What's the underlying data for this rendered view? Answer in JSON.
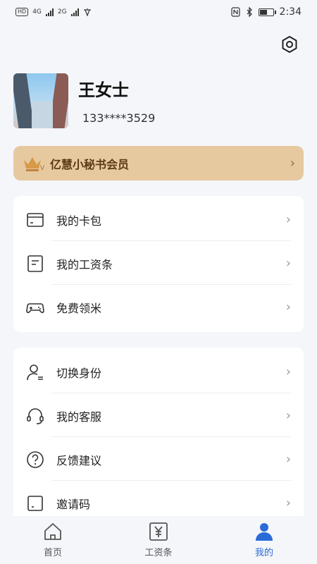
{
  "status_bar": {
    "left_badge": "HD",
    "net1": "4G",
    "net2": "2G",
    "time": "2:34",
    "battery_level": 0.6
  },
  "profile": {
    "name": "王女士",
    "phone": "133****3529"
  },
  "vip": {
    "label": "亿慧小秘书会员"
  },
  "menu_group_1": [
    {
      "label": "我的卡包",
      "icon": "card-wallet-icon"
    },
    {
      "label": "我的工资条",
      "icon": "payslip-icon"
    },
    {
      "label": "免费领米",
      "icon": "gamepad-icon"
    }
  ],
  "menu_group_2": [
    {
      "label": "切换身份",
      "icon": "switch-identity-icon"
    },
    {
      "label": "我的客服",
      "icon": "headset-icon"
    },
    {
      "label": "反馈建议",
      "icon": "feedback-question-icon"
    },
    {
      "label": "邀请码",
      "icon": "invite-code-icon"
    }
  ],
  "tabs": [
    {
      "label": "首页",
      "icon": "home-icon",
      "active": false
    },
    {
      "label": "工资条",
      "icon": "yen-payslip-icon",
      "active": false
    },
    {
      "label": "我的",
      "icon": "person-icon",
      "active": true
    }
  ],
  "colors": {
    "accent": "#2a6bd8",
    "vip_bg": "#e7c9a0",
    "vip_text": "#5b3b14",
    "background": "#f5f6fa"
  }
}
